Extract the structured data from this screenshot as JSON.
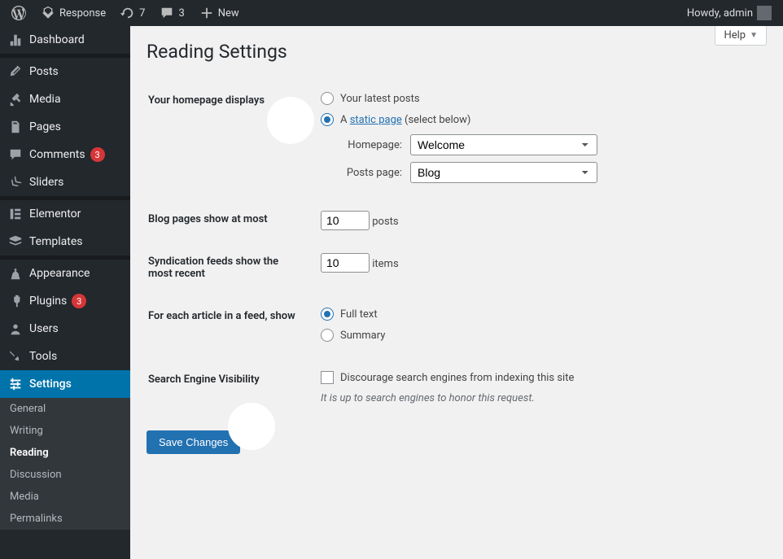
{
  "topbar": {
    "site_name": "Response",
    "updates_count": "7",
    "comments_count": "3",
    "new_label": "New",
    "greeting": "Howdy, admin"
  },
  "help_label": "Help",
  "sidebar": {
    "dashboard": "Dashboard",
    "posts": "Posts",
    "media": "Media",
    "pages": "Pages",
    "comments": "Comments",
    "comments_badge": "3",
    "sliders": "Sliders",
    "elementor": "Elementor",
    "templates": "Templates",
    "appearance": "Appearance",
    "plugins": "Plugins",
    "plugins_badge": "3",
    "users": "Users",
    "tools": "Tools",
    "settings": "Settings"
  },
  "submenu": {
    "general": "General",
    "writing": "Writing",
    "reading": "Reading",
    "discussion": "Discussion",
    "media": "Media",
    "permalinks": "Permalinks"
  },
  "page": {
    "title": "Reading Settings",
    "homepage_displays_label": "Your homepage displays",
    "latest_posts_opt": "Your latest posts",
    "static_page_prefix": "A ",
    "static_page_link": "static page",
    "static_page_suffix": " (select below)",
    "homepage_label": "Homepage:",
    "homepage_value": "Welcome",
    "posts_page_label": "Posts page:",
    "posts_page_value": "Blog",
    "blog_pages_label": "Blog pages show at most",
    "blog_pages_value": "10",
    "blog_pages_suffix": "posts",
    "syndication_label": "Syndication feeds show the most recent",
    "syndication_value": "10",
    "syndication_suffix": "items",
    "feed_article_label": "For each article in a feed, show",
    "full_text_opt": "Full text",
    "summary_opt": "Summary",
    "search_visibility_label": "Search Engine Visibility",
    "search_visibility_checkbox": "Discourage search engines from indexing this site",
    "search_visibility_desc": "It is up to search engines to honor this request.",
    "save_button": "Save Changes"
  }
}
